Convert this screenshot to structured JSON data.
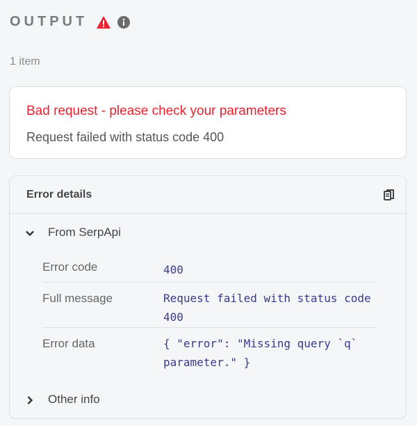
{
  "header": {
    "title": "OUTPUT",
    "warning_icon": "warning-triangle-icon",
    "info_icon": "info-circle-icon",
    "warning_color": "#e8222f"
  },
  "item_count": "1 item",
  "error": {
    "title": "Bad request - please check your parameters",
    "description": "Request failed with status code 400"
  },
  "details": {
    "title": "Error details",
    "copy_icon": "copy-icon",
    "from_section": {
      "label": "From SerpApi",
      "expanded": true,
      "rows": [
        {
          "key": "Error code",
          "value": "400"
        },
        {
          "key": "Full message",
          "value": "Request failed with status code 400"
        },
        {
          "key": "Error data",
          "value": "{ \"error\": \"Missing query `q` parameter.\" }"
        }
      ]
    },
    "other_section": {
      "label": "Other info",
      "expanded": false
    }
  }
}
